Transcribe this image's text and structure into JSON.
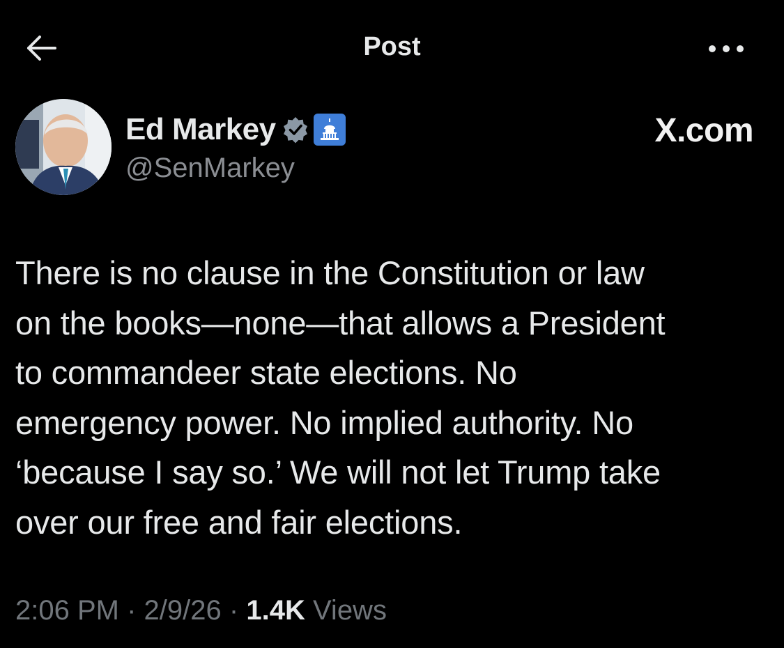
{
  "header": {
    "title": "Post",
    "back_icon": "arrow-left-icon",
    "more_icon": "more-horizontal-icon"
  },
  "author": {
    "display_name": "Ed Markey",
    "handle": "@SenMarkey",
    "verified_badge_icon": "verified-badge-icon",
    "affiliation_badge_icon": "capitol-dome-icon",
    "avatar": "profile-photo"
  },
  "source_watermark": "X.com",
  "post": {
    "text": "There is no clause in the Constitution or law\non the books—none—that allows a President\nto commandeer state elections. No\nemergency power. No implied authority. No\n‘because I say so.’ We will not let Trump take\nover our free and fair elections."
  },
  "meta": {
    "time": "2:06 PM",
    "separator": "·",
    "date": "2/9/26",
    "views_count": "1.4K",
    "views_label": "Views"
  },
  "colors": {
    "background": "#000000",
    "primary_text": "#e7e9ea",
    "secondary_text": "#71767b",
    "badge_gray": "#8b98a5",
    "gov_badge_blue": "#3f7ed8"
  }
}
